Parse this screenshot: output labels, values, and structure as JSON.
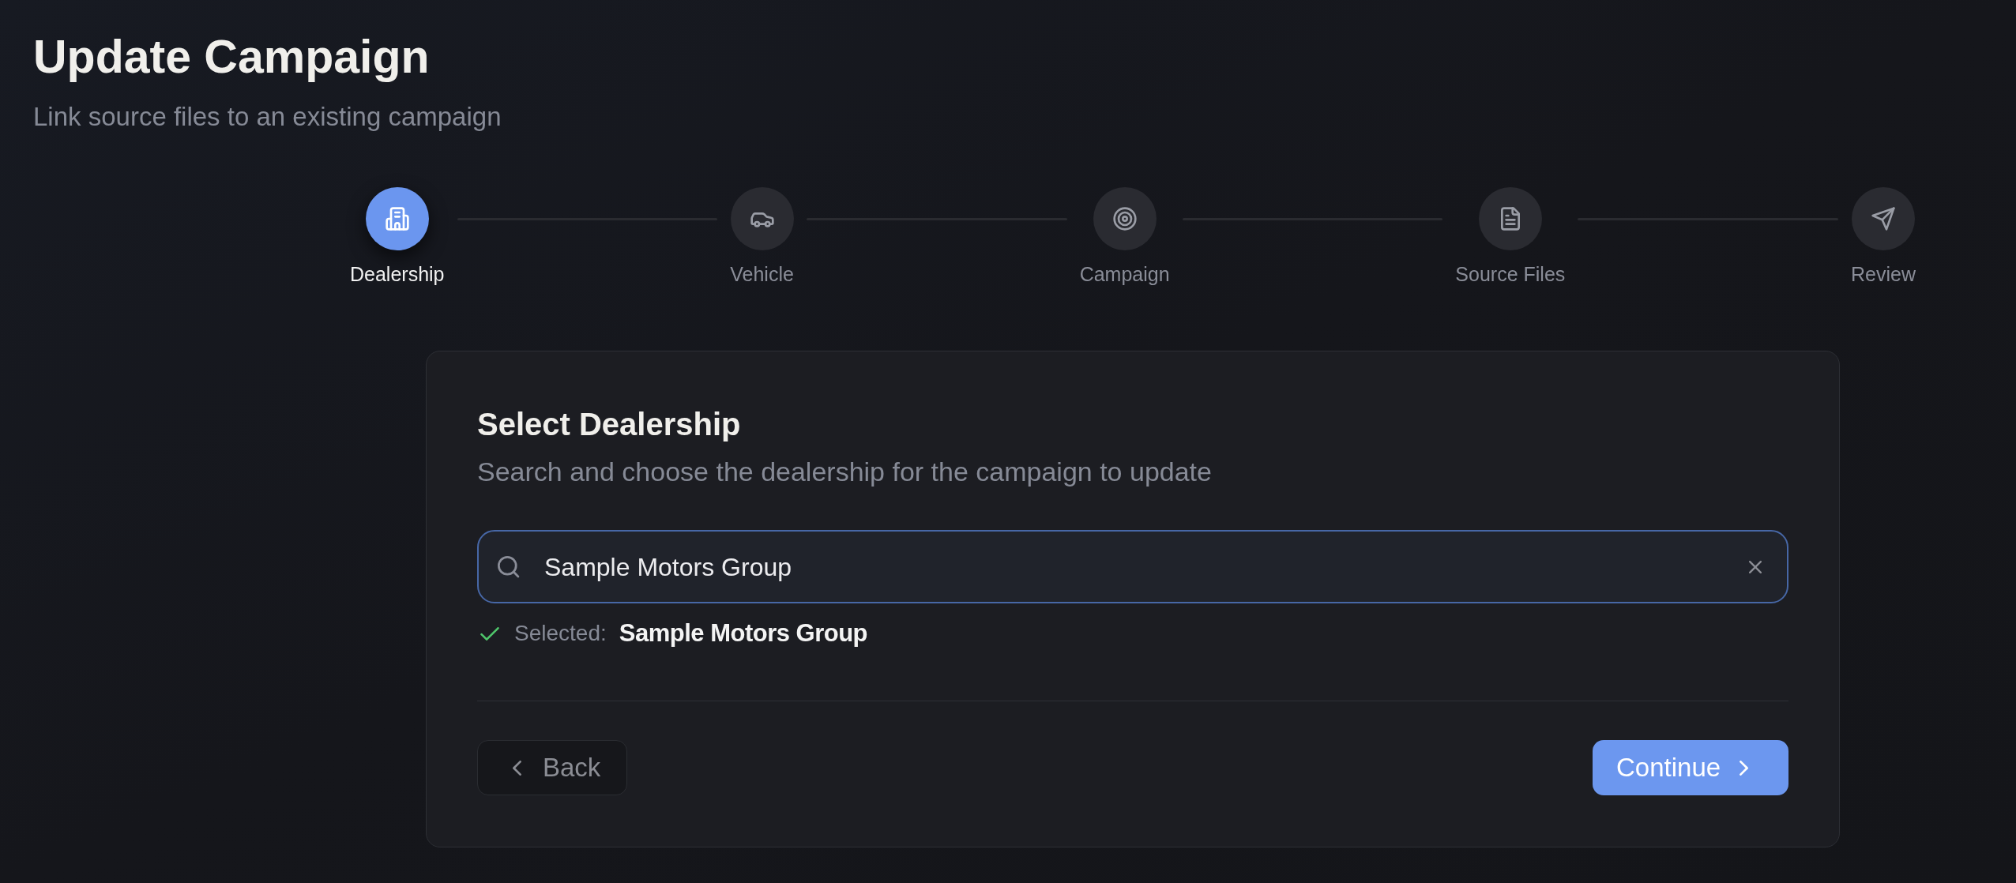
{
  "page": {
    "title": "Update Campaign",
    "subtitle": "Link source files to an existing campaign"
  },
  "stepper": {
    "steps": [
      {
        "label": "Dealership",
        "selected": true
      },
      {
        "label": "Vehicle",
        "selected": false
      },
      {
        "label": "Campaign",
        "selected": false
      },
      {
        "label": "Source Files",
        "selected": false
      },
      {
        "label": "Review",
        "selected": false
      }
    ]
  },
  "card": {
    "title": "Select Dealership",
    "description": "Search and choose the dealership for the campaign to update",
    "search": {
      "value": "Sample Motors Group"
    },
    "selection": {
      "label": "Selected:",
      "value": "Sample Motors Group"
    },
    "buttons": [
      {
        "label": "Back",
        "kind": "secondary"
      },
      {
        "label": "Continue",
        "kind": "primary"
      }
    ]
  }
}
